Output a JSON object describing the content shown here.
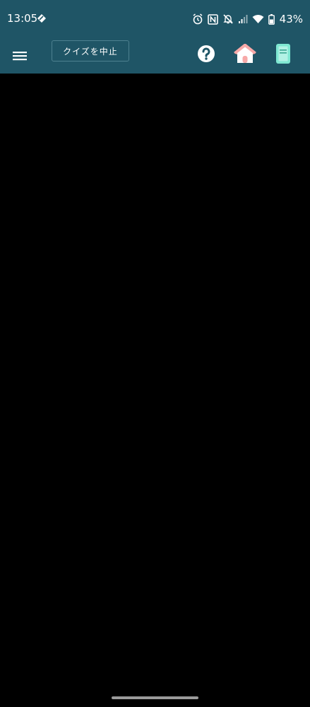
{
  "status_bar": {
    "time": "13:05",
    "battery_percent": "43%",
    "icons": [
      "diamond-notification-icon",
      "alarm-icon",
      "nfc-icon",
      "mute-icon",
      "signal-icon",
      "wifi-icon",
      "battery-icon"
    ]
  },
  "app_bar": {
    "menu_icon": "hamburger-menu-icon",
    "quit_quiz_label": "クイズを中止",
    "help_icon": "help-icon",
    "home_icon": "home-icon",
    "book_icon": "book-icon"
  },
  "colors": {
    "bar_background": "#1f5566",
    "content_background": "#000000",
    "home_icon": "#f7a9a8",
    "book_icon": "#7fe8d2"
  }
}
